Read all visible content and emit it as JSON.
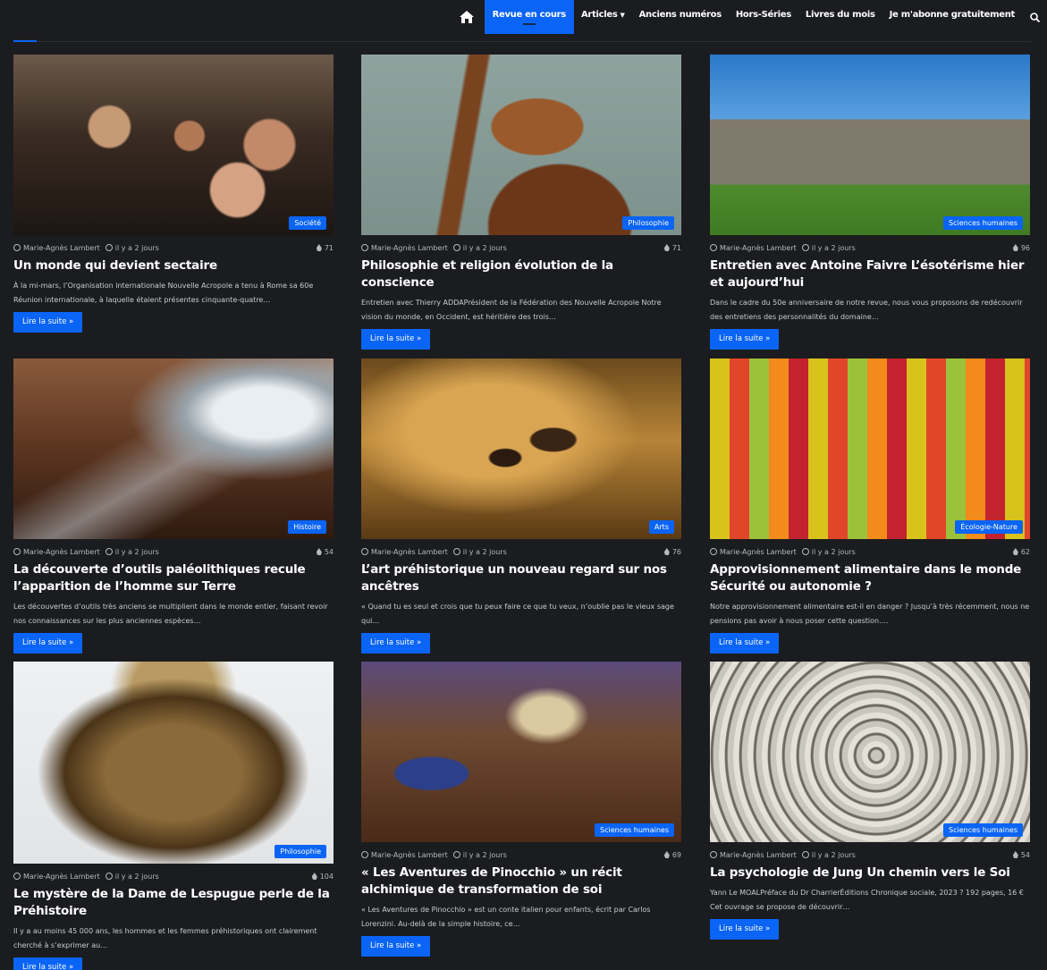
{
  "nav": {
    "items": [
      {
        "label": "Revue en cours",
        "active": true
      },
      {
        "label": "Articles",
        "dropdown": true
      },
      {
        "label": "Anciens numéros"
      },
      {
        "label": "Hors-Séries"
      },
      {
        "label": "Livres du mois"
      },
      {
        "label": "Je m'abonne gratuitement"
      }
    ],
    "icons": [
      "home-icon",
      "search-icon"
    ]
  },
  "colors": {
    "accent": "#0a64f5",
    "background": "#1b1c1f"
  },
  "read_more_label": "Lire la suite »",
  "articles": [
    {
      "category": "Société",
      "author": "Marie-Agnès Lambert",
      "date": "il y a 2 jours",
      "views": "71",
      "title": "Un monde qui devient sectaire",
      "excerpt": "À la mi-mars, l’Organisation internationale Nouvelle Acropole a tenu à Rome sa 60e Réunion internationale, à laquelle étaient présentes cinquante-quatre…"
    },
    {
      "category": "Philosophie",
      "author": "Marie-Agnès Lambert",
      "date": "il y a 2 jours",
      "views": "71",
      "title": "Philosophie et religion évolution de la conscience",
      "excerpt": "Entretien avec Thierry ADDAPrésident de la Fédération des Nouvelle Acropole Notre vision du monde, en Occident, est héritière des trois…"
    },
    {
      "category": "Sciences humaines",
      "author": "Marie-Agnès Lambert",
      "date": "il y a 2 jours",
      "views": "96",
      "title": "Entretien avec Antoine Faivre L’ésotérisme hier et aujourd’hui",
      "excerpt": "Dans le cadre du 50e anniversaire de notre revue, nous vous proposons de redécouvrir des entretiens des personnalités du domaine…"
    },
    {
      "category": "Histoire",
      "author": "Marie-Agnès Lambert",
      "date": "il y a 2 jours",
      "views": "54",
      "title": "La découverte d’outils paléolithiques recule l’apparition de l’homme sur Terre",
      "excerpt": "Les découvertes d’outils très anciens se multiplient dans le monde entier, faisant revoir nos connaissances sur les plus anciennes espèces…"
    },
    {
      "category": "Arts",
      "author": "Marie-Agnès Lambert",
      "date": "il y a 2 jours",
      "views": "76",
      "title": "L’art préhistorique un nouveau regard sur nos ancêtres",
      "excerpt": "« Quand tu es seul et crois que tu peux faire ce que tu veux, n’oublie pas le vieux sage qui…"
    },
    {
      "category": "Écologie-Nature",
      "author": "Marie-Agnès Lambert",
      "date": "il y a 2 jours",
      "views": "62",
      "title": "Approvisionnement alimentaire dans le monde Sécurité ou autonomie ?",
      "excerpt": "Notre approvisionnement alimentaire est-il en danger ? Jusqu’à très récemment, nous ne pensions pas avoir à nous poser cette question.…"
    },
    {
      "category": "Philosophie",
      "author": "Marie-Agnès Lambert",
      "date": "il y a 2 jours",
      "views": "104",
      "title": "Le mystère de la Dame de Lespugue perle de la Préhistoire",
      "excerpt": "Il y a au moins 45 000 ans, les hommes et les femmes préhistoriques ont clairement cherché à s’exprimer au…"
    },
    {
      "category": "Sciences humaines",
      "author": "Marie-Agnès Lambert",
      "date": "il y a 2 jours",
      "views": "69",
      "title": "« Les Aventures de Pinocchio » un récit alchimique de transformation de soi",
      "excerpt": "« Les Aventures de Pinocchio » est un conte italien pour enfants, écrit par Carlos Lorenzini. Au-delà de la simple histoire, ce…"
    },
    {
      "category": "Sciences humaines",
      "author": "Marie-Agnès Lambert",
      "date": "il y a 2 jours",
      "views": "54",
      "title": "La psychologie de Jung Un chemin vers le Soi",
      "excerpt": "Yann Le MOALPréface du Dr CharrierÉditions Chronique sociale, 2023 ? 192 pages, 16 € Cet ouvrage se propose de découvrir…"
    }
  ]
}
